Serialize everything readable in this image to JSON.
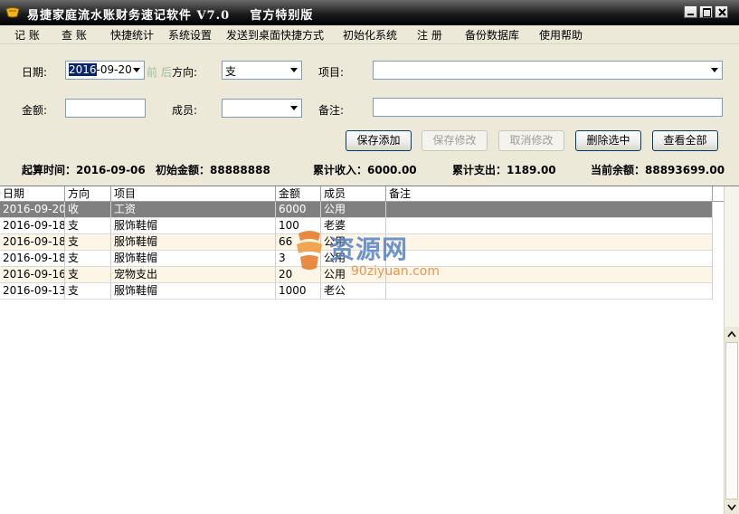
{
  "window": {
    "title": "易捷家庭流水账财务速记软件 V7.0    官方特别版"
  },
  "menu": [
    {
      "label": "记 账"
    },
    {
      "label": "查 账"
    },
    {
      "label": "快捷统计"
    },
    {
      "label": "系统设置"
    },
    {
      "label": "发送到桌面快捷方式"
    },
    {
      "label": "初始化系统"
    },
    {
      "label": "注 册"
    },
    {
      "label": "备份数据库"
    },
    {
      "label": "使用帮助"
    }
  ],
  "form": {
    "date_label": "日期:",
    "date_year": "2016",
    "date_rest": "-09-20",
    "prev_label": "前",
    "next_label": "后",
    "direction_label": "方向:",
    "direction_value": "支",
    "item_label": "项目:",
    "item_value": "",
    "amount_label": "金额:",
    "amount_value": "",
    "member_label": "成员:",
    "member_value": "",
    "note_label": "备注:",
    "note_value": ""
  },
  "buttons": {
    "save_add": "保存添加",
    "save_edit": "保存修改",
    "cancel_edit": "取消修改",
    "delete_selected": "删除选中",
    "view_all": "查看全部"
  },
  "summary": {
    "start_time": "起算时间：2016-09-06",
    "initial_amount": "初始金额：88888888",
    "total_income": "累计收入：6000.00",
    "total_expense": "累计支出：1189.00",
    "current_balance": "当前余额：88893699.00"
  },
  "table": {
    "headers": [
      "日期",
      "方向",
      "项目",
      "金额",
      "成员",
      "备注"
    ],
    "rows": [
      [
        "2016-09-20",
        "收",
        "工资",
        "6000",
        "公用",
        ""
      ],
      [
        "2016-09-18",
        "支",
        "服饰鞋帽",
        "100",
        "老婆",
        ""
      ],
      [
        "2016-09-18",
        "支",
        "服饰鞋帽",
        "66",
        "公用",
        ""
      ],
      [
        "2016-09-18",
        "支",
        "服饰鞋帽",
        "3",
        "公用",
        ""
      ],
      [
        "2016-09-16",
        "支",
        "宠物支出",
        "20",
        "公用",
        ""
      ],
      [
        "2016-09-13",
        "支",
        "服饰鞋帽",
        "1000",
        "老公",
        ""
      ]
    ]
  },
  "watermark": {
    "cn": "资源网",
    "en": "90ziyuan.com"
  },
  "colors": {
    "titlebar": "#1c1c1c",
    "selected_row": "#808080",
    "alt_row": "#fdf5e6",
    "button_border": "#003c74"
  }
}
